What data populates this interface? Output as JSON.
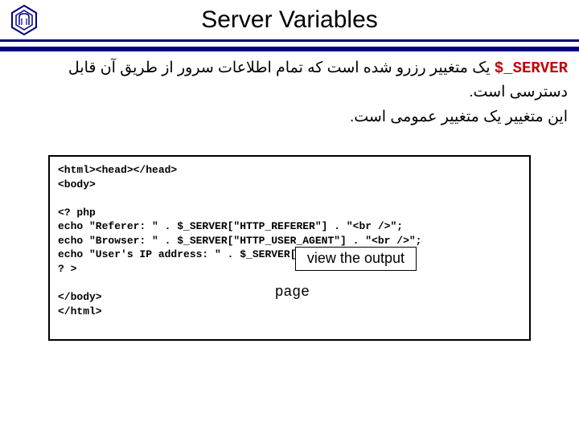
{
  "header": {
    "title": "Server Variables"
  },
  "description": {
    "keyword": "$_SERVER",
    "line1_rest": " یک متغییر رزرو شده است که تمام اطلاعات سرور از طریق آن قابل دسترسی است.",
    "line2": "این متغییر یک متغییر عمومی است."
  },
  "code": {
    "l1": "<html><head></head>",
    "l2": "<body>",
    "l3": "",
    "l4": "<? php",
    "l5": "echo \"Referer: \" . $_SERVER[\"HTTP_REFERER\"] . \"<br />\";",
    "l6": "echo \"Browser: \" . $_SERVER[\"HTTP_USER_AGENT\"] . \"<br />\";",
    "l7": "echo \"User's IP address: \" . $_SERVER[\"REMOTE_ADDR\"];",
    "l8": "? >",
    "l9": "",
    "l10": "</body>",
    "l11": "</html>"
  },
  "button": {
    "label": "view the output",
    "page": "page"
  }
}
